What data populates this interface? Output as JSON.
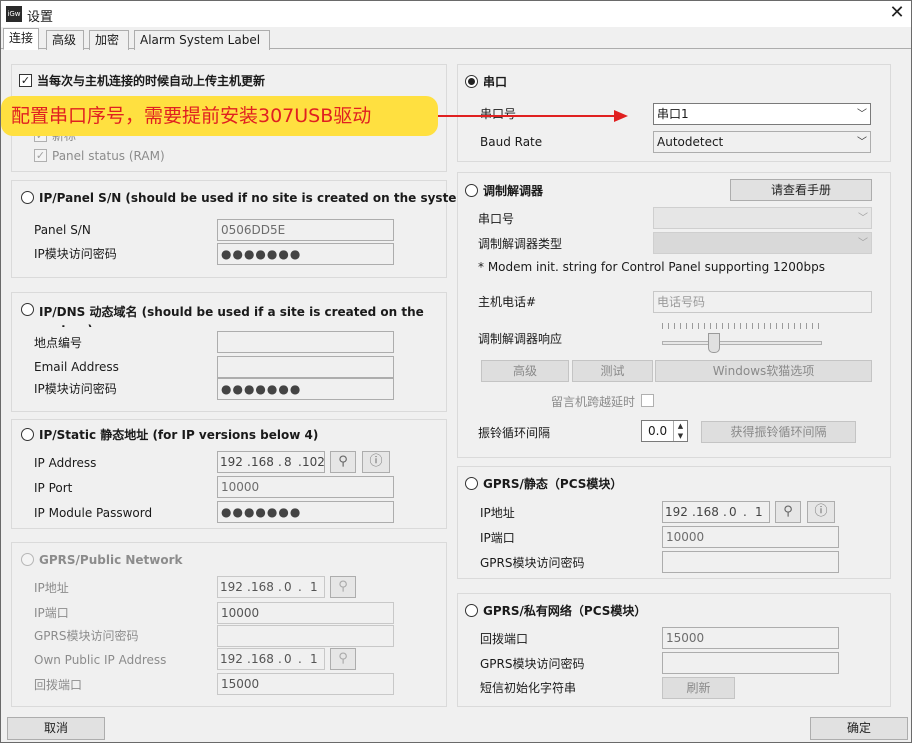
{
  "window": {
    "title": "设置",
    "app_icon_text": "iGw",
    "close_glyph": "✕"
  },
  "tabs": [
    {
      "label": "连接",
      "active": true
    },
    {
      "label": "高级"
    },
    {
      "label": "加密"
    },
    {
      "label": "Alarm System Label"
    }
  ],
  "callout": {
    "text": "配置串口序号，需要提前安装307USB驱动",
    "color": "#e02020",
    "bg": "#ffe040"
  },
  "left": {
    "auto_update": {
      "label": "当每次与主机连接的时候自动上传主机更新",
      "checked": true
    },
    "hidden_option": {
      "label": "新标",
      "checked": true
    },
    "panel_status": {
      "label": "Panel status (RAM)",
      "checked": true
    },
    "ip_panel_sn": {
      "title": "IP/Panel S/N (should be used if no site is created on the system)",
      "sn_label": "Panel S/N",
      "sn_value": "0506DD5E",
      "pwd_label": "IP模块访问密码",
      "pwd_value": "●●●●●●●"
    },
    "ip_dns": {
      "title": "IP/DNS 动态域名 (should be used if a site is created on the system)",
      "site_label": "地点编号",
      "site_value": "",
      "email_label": "Email Address",
      "email_value": "",
      "pwd_label": "IP模块访问密码",
      "pwd_value": "●●●●●●●"
    },
    "ip_static": {
      "title": "IP/Static 静态地址 (for IP versions below 4)",
      "addr_label": "IP Address",
      "addr": [
        "192",
        "168",
        "8",
        "102"
      ],
      "port_label": "IP Port",
      "port_value": "10000",
      "pwd_label": "IP Module Password",
      "pwd_value": "●●●●●●●"
    },
    "gprs_public": {
      "title": "GPRS/Public Network",
      "addr_label": "IP地址",
      "addr": [
        "192",
        "168",
        "0",
        "1"
      ],
      "port_label": "IP端口",
      "port_value": "10000",
      "pwd_label": "GPRS模块访问密码",
      "pwd_value": "",
      "own_ip_label": "Own Public IP Address",
      "own_ip": [
        "192",
        "168",
        "0",
        "1"
      ],
      "callback_label": "回拨端口",
      "callback_value": "15000"
    }
  },
  "right": {
    "serial": {
      "title": "串口",
      "port_label": "串口号",
      "port_value": "串口1",
      "baud_label": "Baud Rate",
      "baud_value": "Autodetect"
    },
    "modem": {
      "title": "调制解调器",
      "manual_button": "请查看手册",
      "port_label": "串口号",
      "type_label": "调制解调器类型",
      "note": "* Modem init. string for Control Panel supporting 1200bps",
      "phone_label": "主机电话#",
      "phone_placeholder": "电话号码",
      "response_label": "调制解调器响应",
      "btn_advanced": "高级",
      "btn_test": "测试",
      "btn_windows": "Windows软猫选项",
      "answer_delay_label": "留言机跨越延时",
      "ring_label": "振铃循环间隔",
      "ring_value": "0.0",
      "ring_button": "获得振铃循环间隔"
    },
    "gprs_static": {
      "title": "GPRS/静态（PCS模块）",
      "addr_label": "IP地址",
      "addr": [
        "192",
        "168",
        "0",
        "1"
      ],
      "port_label": "IP端口",
      "port_value": "10000",
      "pwd_label": "GPRS模块访问密码",
      "pwd_value": ""
    },
    "gprs_private": {
      "title": "GPRS/私有网络（PCS模块）",
      "callback_label": "回拨端口",
      "callback_value": "15000",
      "pwd_label": "GPRS模块访问密码",
      "pwd_value": "",
      "sms_label": "短信初始化字符串",
      "refresh_button": "刷新"
    }
  },
  "footer": {
    "cancel": "取消",
    "ok": "确定"
  }
}
